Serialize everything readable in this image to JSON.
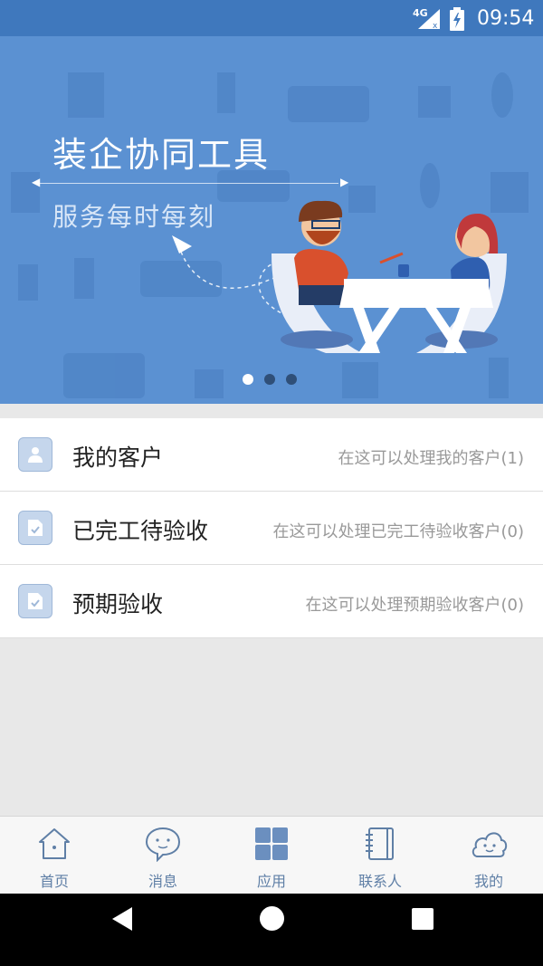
{
  "status_bar": {
    "network": "4G",
    "time": "09:54"
  },
  "banner": {
    "title": "装企协同工具",
    "subtitle": "服务每时每刻",
    "active_slide": 1,
    "slide_count": 3
  },
  "menu": {
    "items": [
      {
        "icon": "user-icon",
        "title": "我的客户",
        "description": "在这可以处理我的客户(1)"
      },
      {
        "icon": "document-check-icon",
        "title": "已完工待验收",
        "description": "在这可以处理已完工待验收客户(0)"
      },
      {
        "icon": "document-check-icon",
        "title": "预期验收",
        "description": "在这可以处理预期验收客户(0)"
      }
    ]
  },
  "tab_bar": {
    "tabs": [
      {
        "icon": "home-icon",
        "label": "首页"
      },
      {
        "icon": "message-bubble-icon",
        "label": "消息"
      },
      {
        "icon": "grid-apps-icon",
        "label": "应用"
      },
      {
        "icon": "contacts-book-icon",
        "label": "联系人"
      },
      {
        "icon": "cloud-face-icon",
        "label": "我的"
      }
    ],
    "active_index": 2
  },
  "colors": {
    "status_bar": "#3f78bd",
    "banner": "#5b91d2",
    "tab_icon": "#5f7fa6",
    "active_tab_icon": "#6b8fbf"
  }
}
